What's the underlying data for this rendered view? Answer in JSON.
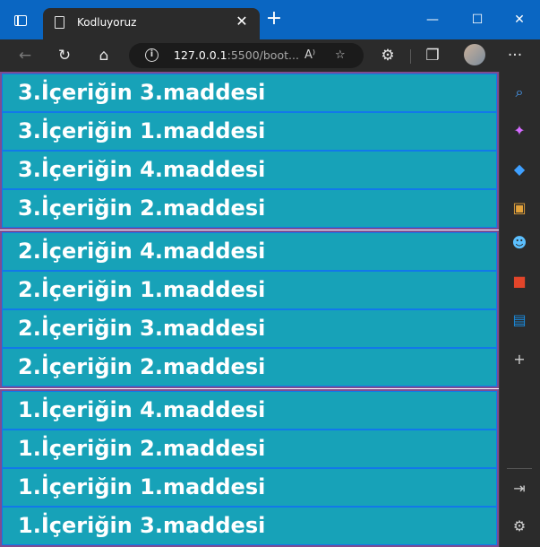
{
  "browser": {
    "tab_title": "Kodluyoruz",
    "new_tab_label": "+",
    "close_tab_label": "✕",
    "url_host": "127.0.0.1",
    "url_rest": ":5500/boot...",
    "read_aloud_label": "A⁾",
    "window_controls": {
      "minimize": "—",
      "maximize": "☐",
      "close": "✕"
    },
    "menu_label": "···"
  },
  "sidebar": {
    "icons": [
      "search-icon",
      "copilot-icon",
      "tag-icon",
      "toolbox-icon",
      "games-icon",
      "office-icon",
      "outlook-icon",
      "add-icon",
      "hide-sidebar-icon",
      "settings-icon"
    ],
    "add_label": "+"
  },
  "content": {
    "groups": [
      {
        "items": [
          "3.İçeriğin 3.maddesi",
          "3.İçeriğin 1.maddesi",
          "3.İçeriğin 4.maddesi",
          "3.İçeriğin 2.maddesi"
        ]
      },
      {
        "items": [
          "2.İçeriğin 4.maddesi",
          "2.İçeriğin 1.maddesi",
          "2.İçeriğin 3.maddesi",
          "2.İçeriğin 2.maddesi"
        ]
      },
      {
        "items": [
          "1.İçeriğin 4.maddesi",
          "1.İçeriğin 2.maddesi",
          "1.İçeriğin 1.maddesi",
          "1.İçeriğin 3.maddesi"
        ]
      }
    ]
  },
  "colors": {
    "title_bar": "#0a66c2",
    "item_background": "#17a2b8",
    "item_border": "#1278ea",
    "group_border": "#7e4d90"
  }
}
